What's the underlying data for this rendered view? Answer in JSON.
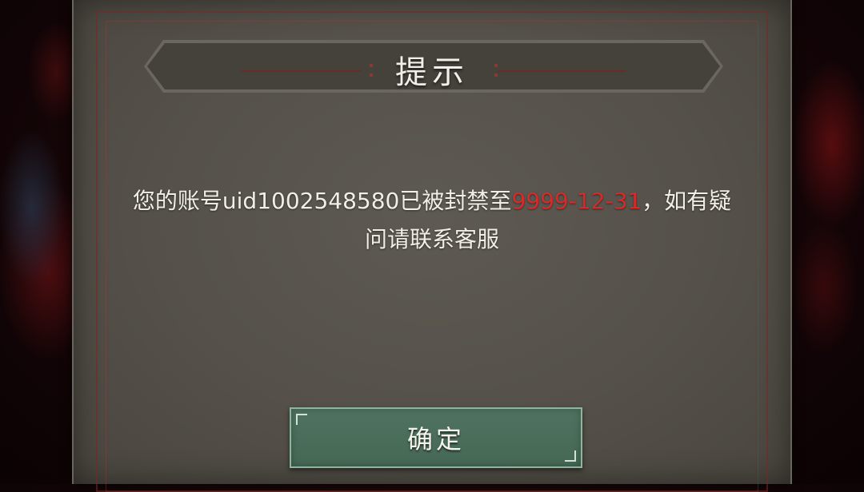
{
  "dialog": {
    "title": "提示",
    "message_prefix": "您的账号uid1002548580已被封禁至",
    "ban_until": "9999-12-31",
    "message_suffix": "，如有疑问请联系客服",
    "confirm_label": "确定"
  },
  "colors": {
    "highlight": "#d62b2b",
    "button_bg": "#4a6e5a",
    "panel_bg": "#57534c"
  }
}
